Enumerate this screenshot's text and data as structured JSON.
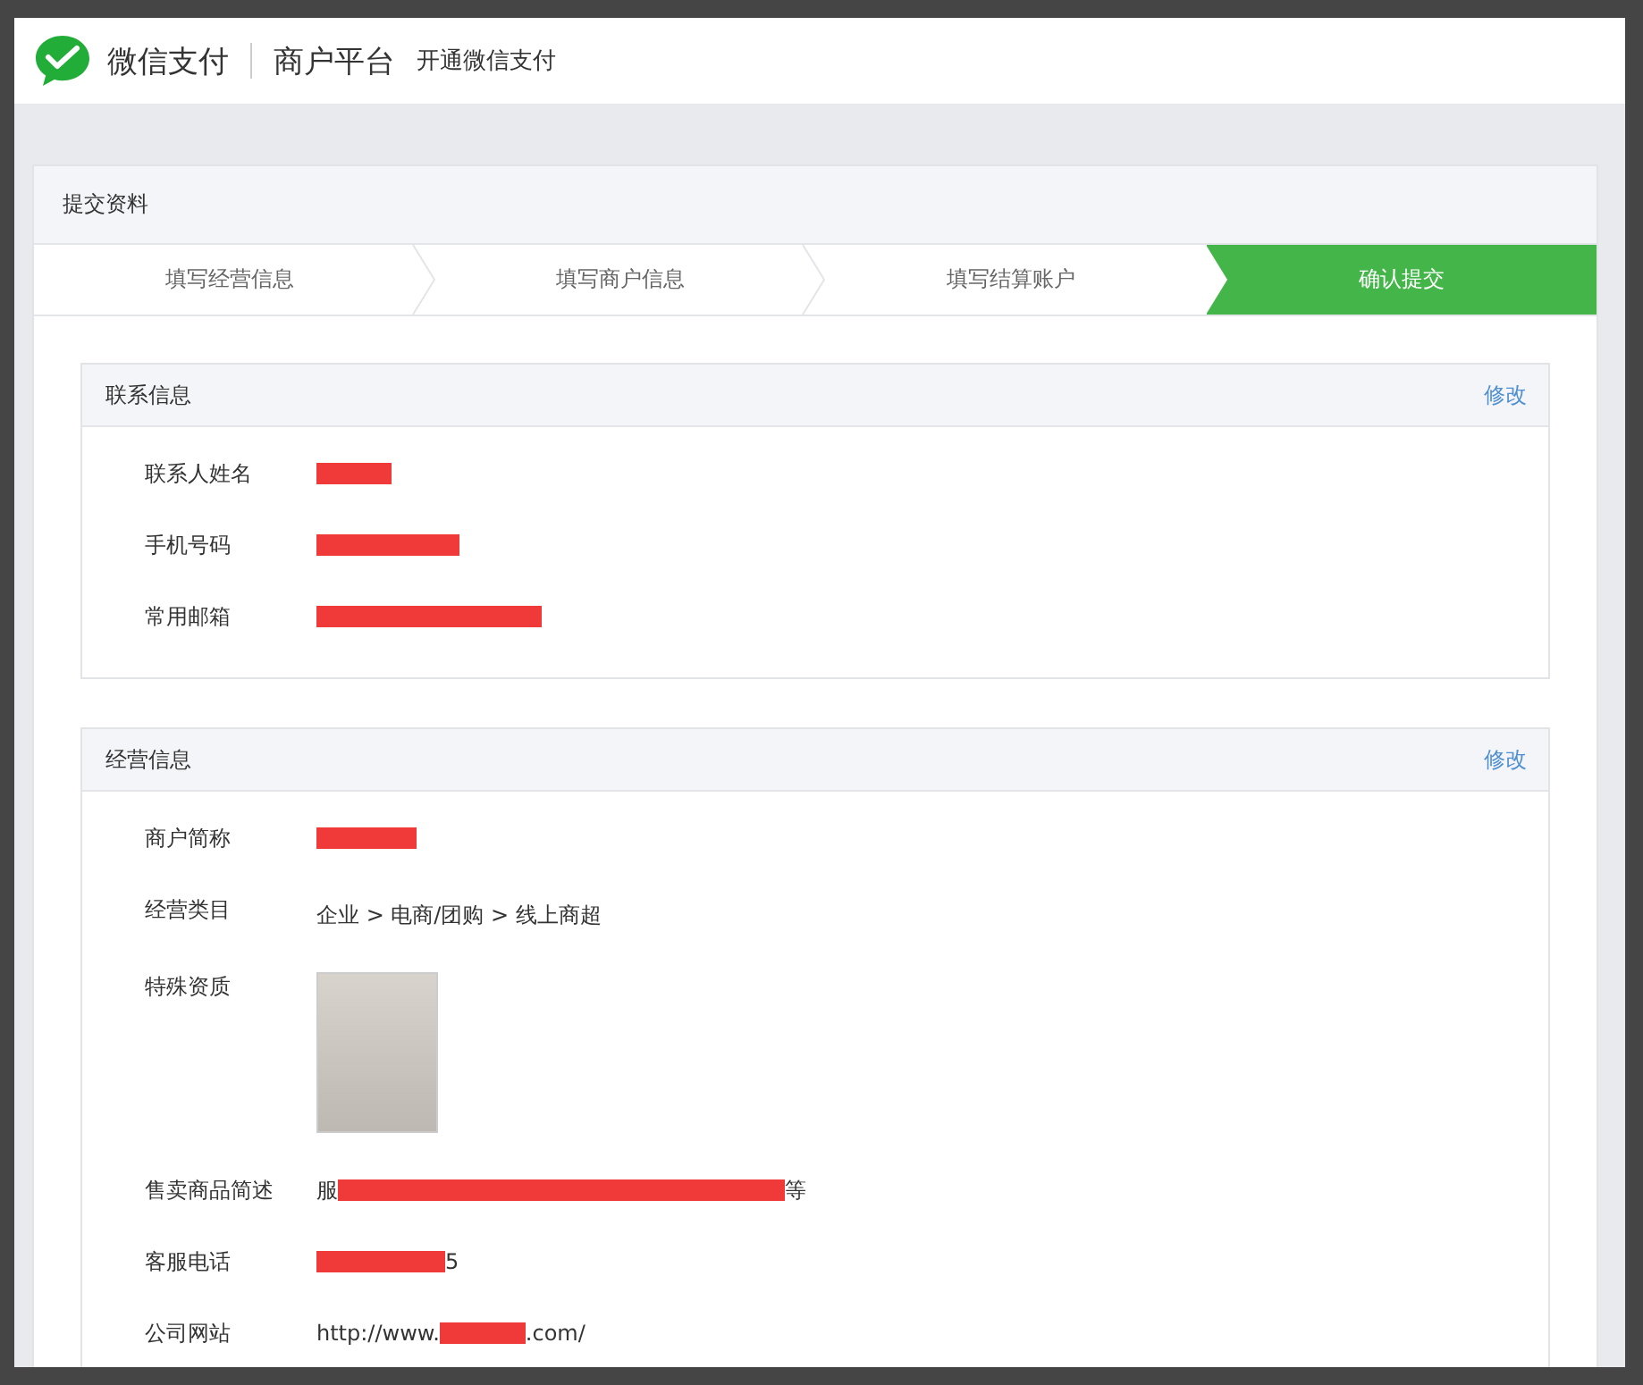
{
  "header": {
    "brand": "微信支付",
    "platform": "商户平台",
    "page": "开通微信支付"
  },
  "panel": {
    "title": "提交资料",
    "steps": [
      {
        "label": "填写经营信息",
        "selected": false
      },
      {
        "label": "填写商户信息",
        "selected": false
      },
      {
        "label": "填写结算账户",
        "selected": false
      },
      {
        "label": "确认提交",
        "selected": true
      }
    ],
    "sections": [
      {
        "title": "联系信息",
        "action": "修改",
        "fields": [
          {
            "label": "联系人姓名",
            "kind": "redacted"
          },
          {
            "label": "手机号码",
            "kind": "redacted"
          },
          {
            "label": "常用邮箱",
            "kind": "redacted"
          }
        ]
      },
      {
        "title": "经营信息",
        "action": "修改",
        "fields": [
          {
            "label": "商户简称",
            "kind": "redacted"
          },
          {
            "label": "经营类目",
            "kind": "text",
            "value": "企业 > 电商/团购 > 线上商超"
          },
          {
            "label": "特殊资质",
            "kind": "image"
          },
          {
            "label": "售卖商品简述",
            "kind": "redacted",
            "before": "服",
            "after": "等"
          },
          {
            "label": "客服电话",
            "kind": "redacted",
            "after": "5"
          },
          {
            "label": "公司网站",
            "kind": "redacted",
            "before": "http://www.",
            "after": ".com/"
          }
        ]
      }
    ]
  }
}
